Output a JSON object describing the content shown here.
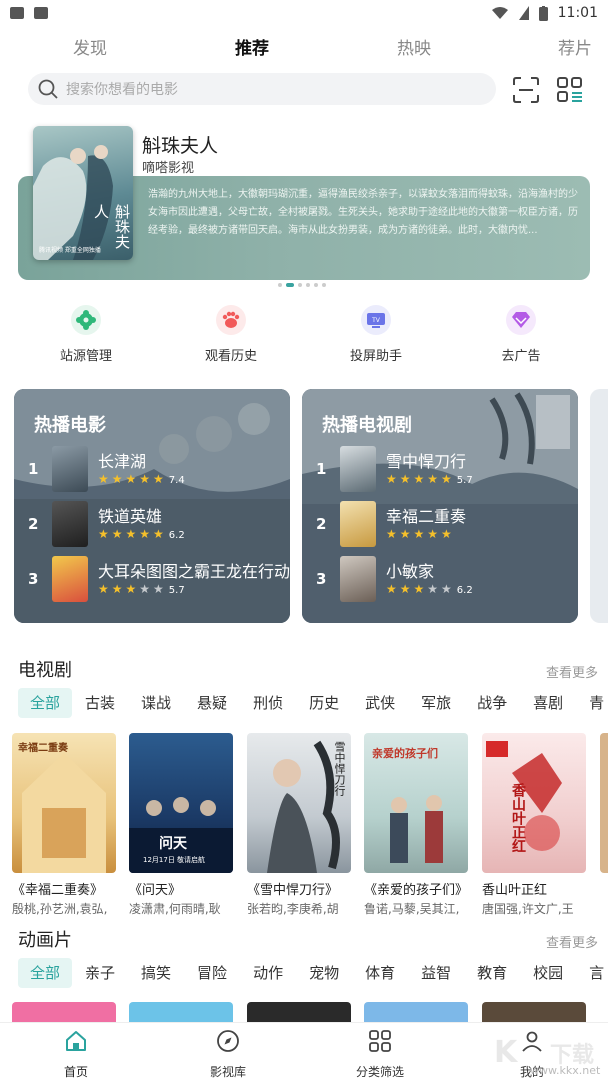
{
  "status_bar": {
    "time": "11:01"
  },
  "top_tabs": [
    {
      "label": "发现"
    },
    {
      "label": "推荐"
    },
    {
      "label": "热映"
    },
    {
      "label": "荐片"
    }
  ],
  "search": {
    "placeholder": "搜索你想看的电影"
  },
  "banner": {
    "title": "斛珠夫人",
    "subtitle": "嘀嗒影视",
    "description": "浩瀚的九州大地上，大徽朝玛瑚沉重，逼得渔民绞杀亲子，以谋蚊女落泪而得蚊珠，沿海渔村的少女海市因此遭遇，父母亡故，全村被屠戮。生死关头，她求助于途经此地的大徽第一权臣方诸，历经考验，最终被方诸带回天启。海市从此女扮男装，成为方诸的徒弟。此时，大徽内忧...",
    "poster_caption": "腾讯视频 郑重全网独播",
    "poster_art_text": "斛珠夫人"
  },
  "quick_actions": [
    {
      "label": "站源管理",
      "icon": "gear-icon",
      "color": "#2fb87a"
    },
    {
      "label": "观看历史",
      "icon": "paw-icon",
      "color": "#f15a5a"
    },
    {
      "label": "投屏助手",
      "icon": "tv-icon",
      "color": "#6a74e8"
    },
    {
      "label": "去广告",
      "icon": "diamond-icon",
      "color": "#b45be6"
    }
  ],
  "hot_movies": {
    "title": "热播电影",
    "items": [
      {
        "rank": "1",
        "name": "长津湖",
        "stars": 5,
        "score": "7.4"
      },
      {
        "rank": "2",
        "name": "铁道英雄",
        "stars": 5,
        "score": "6.2"
      },
      {
        "rank": "3",
        "name": "大耳朵图图之霸王龙在行动",
        "stars": 3,
        "score": "5.7"
      }
    ]
  },
  "hot_tv": {
    "title": "热播电视剧",
    "items": [
      {
        "rank": "1",
        "name": "雪中悍刀行",
        "stars": 5,
        "score": "5.7"
      },
      {
        "rank": "2",
        "name": "幸福二重奏",
        "stars": 5,
        "score": ""
      },
      {
        "rank": "3",
        "name": "小敏家",
        "stars": 3,
        "score": "6.2"
      }
    ]
  },
  "tv_section": {
    "title": "电视剧",
    "more": "查看更多",
    "categories": [
      "全部",
      "古装",
      "谍战",
      "悬疑",
      "刑侦",
      "历史",
      "武侠",
      "军旅",
      "战争",
      "喜剧",
      "青"
    ],
    "items": [
      {
        "title": "《幸福二重奏》",
        "cast": "殷桃,孙艺洲,袁弘,",
        "poster_text": "幸福二重奏"
      },
      {
        "title": "《问天》",
        "cast": "凌潇肃,何雨晴,耿",
        "poster_text": "问天",
        "poster_sub": "12月17日 敬请启航"
      },
      {
        "title": "《雪中悍刀行》",
        "cast": "张若昀,李庚希,胡",
        "poster_text": "雪中悍刀行"
      },
      {
        "title": "《亲爱的孩子们》",
        "cast": "鲁诺,马藜,吴其江,",
        "poster_text": "亲爱的孩子们"
      },
      {
        "title": "香山叶正红",
        "cast": "唐国强,许文广,王",
        "poster_text": "香山叶正红"
      }
    ]
  },
  "anim_section": {
    "title": "动画片",
    "more": "查看更多",
    "categories": [
      "全部",
      "亲子",
      "搞笑",
      "冒险",
      "动作",
      "宠物",
      "体育",
      "益智",
      "教育",
      "校园",
      "言"
    ]
  },
  "bottom_nav": [
    {
      "label": "首页",
      "icon": "home-icon"
    },
    {
      "label": "影视库",
      "icon": "compass-icon"
    },
    {
      "label": "分类筛选",
      "icon": "grid-icon"
    },
    {
      "label": "我的",
      "icon": "user-icon"
    }
  ],
  "watermark": {
    "text": "www.kkx.net"
  },
  "colors": {
    "accent": "#2aa39e",
    "star": "#f5c02b"
  }
}
